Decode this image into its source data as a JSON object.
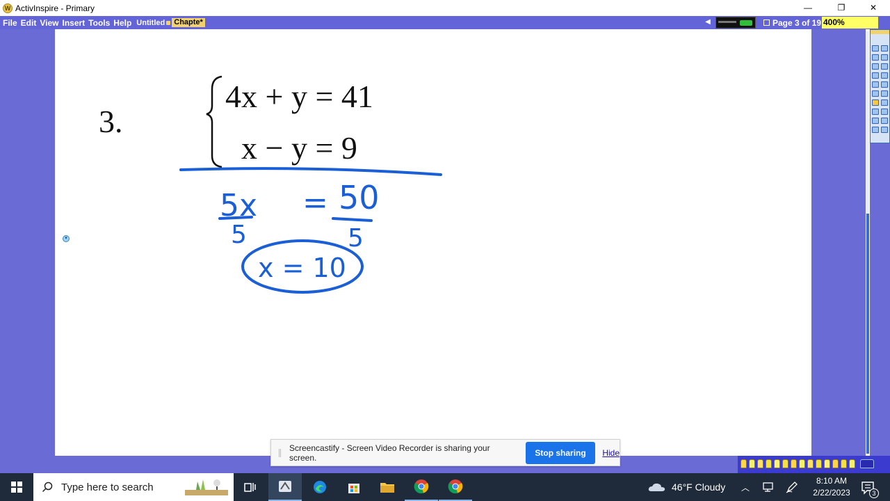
{
  "window": {
    "title": "ActivInspire - Primary",
    "app_icon_glyph": "W",
    "minimize_glyph": "—",
    "restore_glyph": "❐",
    "close_glyph": "✕"
  },
  "menu": {
    "items": [
      "File",
      "Edit",
      "View",
      "Insert",
      "Tools",
      "Help"
    ],
    "doc_tabs": [
      "Untitled",
      "Chapte*"
    ],
    "page_indicator": "Page 3 of 19",
    "zoom": "400%"
  },
  "problem": {
    "number": "3.",
    "equation_1": "4x + y = 41",
    "equation_2": "x − y = 9"
  },
  "handwriting": {
    "lhs": "5x",
    "equals": "=",
    "rhs": "50",
    "divisor_left": "5",
    "divisor_right": "5",
    "answer": "x = 10"
  },
  "sharebar": {
    "message": "Screencastify - Screen Video Recorder is sharing your screen.",
    "stop_label": "Stop sharing",
    "hide_label": "Hide"
  },
  "taskbar": {
    "search_placeholder": "Type here to search",
    "weather": "46°F  Cloudy",
    "time": "8:10 AM",
    "date": "2/22/2023",
    "notification_count": "3"
  },
  "colors": {
    "chrome_purple": "#6b6bd6",
    "ink_blue": "#1b5fd6",
    "zoom_highlight": "#ffff66",
    "stop_button": "#1a73e8",
    "taskbar": "#1f2a3a"
  }
}
